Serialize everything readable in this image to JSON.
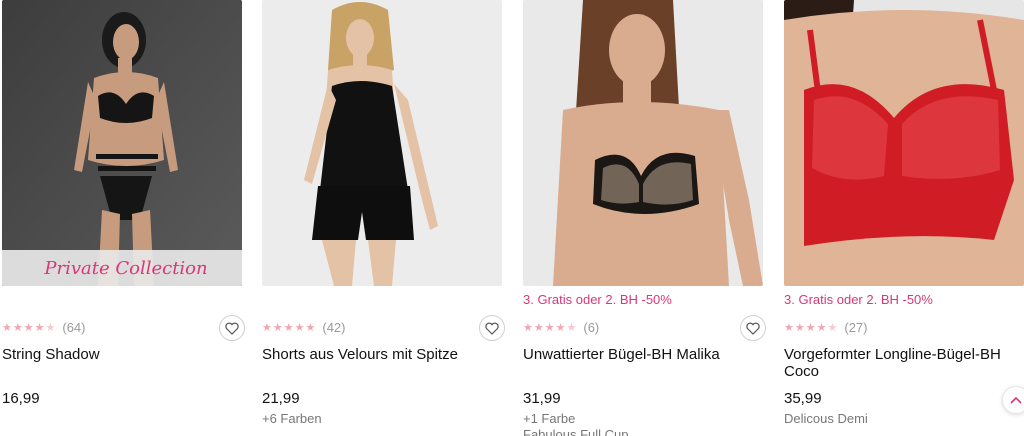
{
  "colors": {
    "accent": "#d8377a",
    "star": "#f2a6b1"
  },
  "products": [
    {
      "image_label": "Private Collection",
      "promo": "",
      "rating_count": "(64)",
      "name": "String Shadow",
      "price": "16,99",
      "colors_text": "",
      "line": ""
    },
    {
      "image_label": "",
      "promo": "",
      "rating_count": "(42)",
      "name": "Shorts aus Velours mit Spitze",
      "price": "21,99",
      "colors_text": "+6 Farben",
      "line": ""
    },
    {
      "image_label": "",
      "promo": "3. Gratis oder 2. BH -50%",
      "rating_count": "(6)",
      "name": "Unwattierter Bügel-BH Malika",
      "price": "31,99",
      "colors_text": "+1 Farbe",
      "line": "Fabulous Full Cup"
    },
    {
      "image_label": "",
      "promo": "3. Gratis oder 2. BH -50%",
      "rating_count": "(27)",
      "name": "Vorgeformter Longline-Bügel-BH Coco",
      "price": "35,99",
      "colors_text": "Delicous Demi",
      "line": ""
    }
  ],
  "icons": {
    "wishlist": "heart-icon",
    "scroll_top": "chevron-up-icon"
  }
}
